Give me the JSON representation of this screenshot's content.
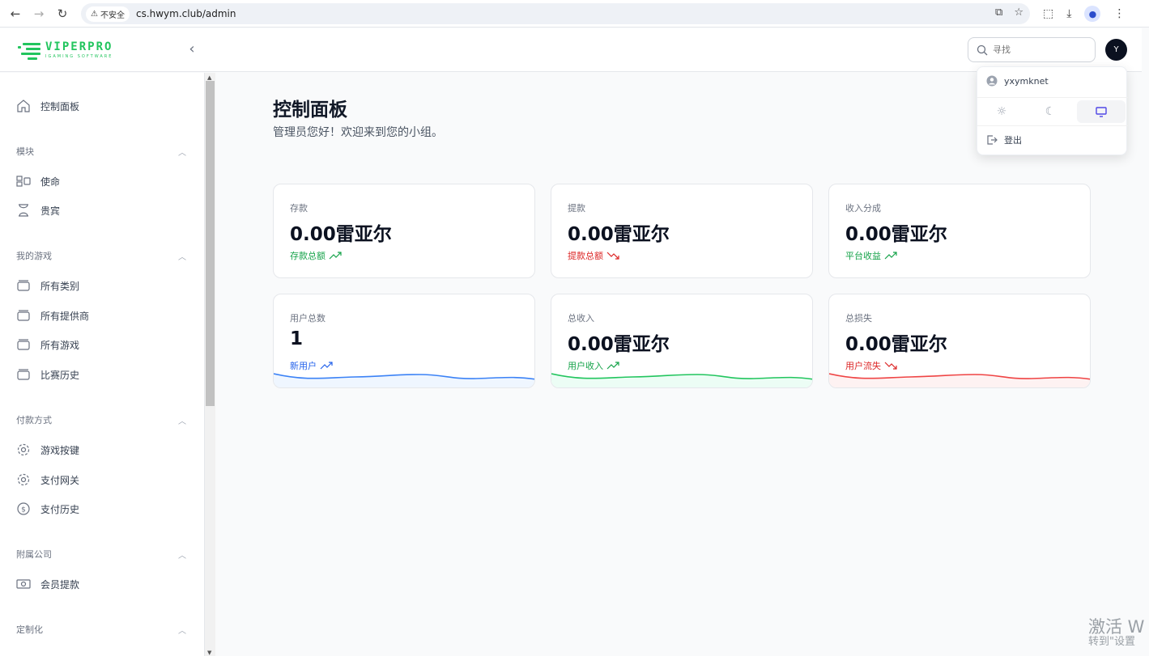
{
  "browser": {
    "insecure_label": "不安全",
    "url": "cs.hwym.club/admin"
  },
  "header": {
    "logo_title": "VIPERPRO",
    "logo_subtitle": "IGAMING SOFTWARE",
    "search_placeholder": "寻找",
    "avatar_initial": "Y"
  },
  "sidebar": {
    "dashboard": "控制面板",
    "groups": {
      "modules": "模块",
      "my_games": "我的游戏",
      "payments": "付款方式",
      "affiliates": "附属公司",
      "customize": "定制化"
    },
    "items": {
      "mission": "使命",
      "vip": "贵宾",
      "all_categories": "所有类别",
      "all_providers": "所有提供商",
      "all_games": "所有游戏",
      "match_history": "比赛历史",
      "game_keys": "游戏按键",
      "payment_gateway": "支付网关",
      "payment_history": "支付历史",
      "member_withdraw": "会员提款"
    }
  },
  "main": {
    "title": "控制面板",
    "subtitle": "管理员您好！欢迎来到您的小组。"
  },
  "cards": [
    {
      "label": "存款",
      "value": "0.00雷亚尔",
      "trend_text": "存款总额",
      "trend": "up",
      "color": "#16a34a"
    },
    {
      "label": "提款",
      "value": "0.00雷亚尔",
      "trend_text": "提款总额",
      "trend": "down",
      "color": "#dc2626"
    },
    {
      "label": "收入分成",
      "value": "0.00雷亚尔",
      "trend_text": "平台收益",
      "trend": "up",
      "color": "#16a34a"
    },
    {
      "label": "用户总数",
      "value": "1",
      "trend_text": "新用户",
      "trend": "up",
      "color": "#2563eb"
    },
    {
      "label": "总收入",
      "value": "0.00雷亚尔",
      "trend_text": "用户收入",
      "trend": "up",
      "color": "#16a34a"
    },
    {
      "label": "总损失",
      "value": "0.00雷亚尔",
      "trend_text": "用户流失",
      "trend": "down",
      "color": "#dc2626"
    }
  ],
  "sparkline_colors": [
    "#3b82f6",
    "#22c55e",
    "#ef4444"
  ],
  "dropdown": {
    "username": "yxymknet",
    "logout": "登出",
    "themes": [
      "light",
      "dark",
      "system"
    ],
    "active_theme": "system"
  },
  "watermark": {
    "line1": "激活 W",
    "line2": "转到\"设置"
  }
}
